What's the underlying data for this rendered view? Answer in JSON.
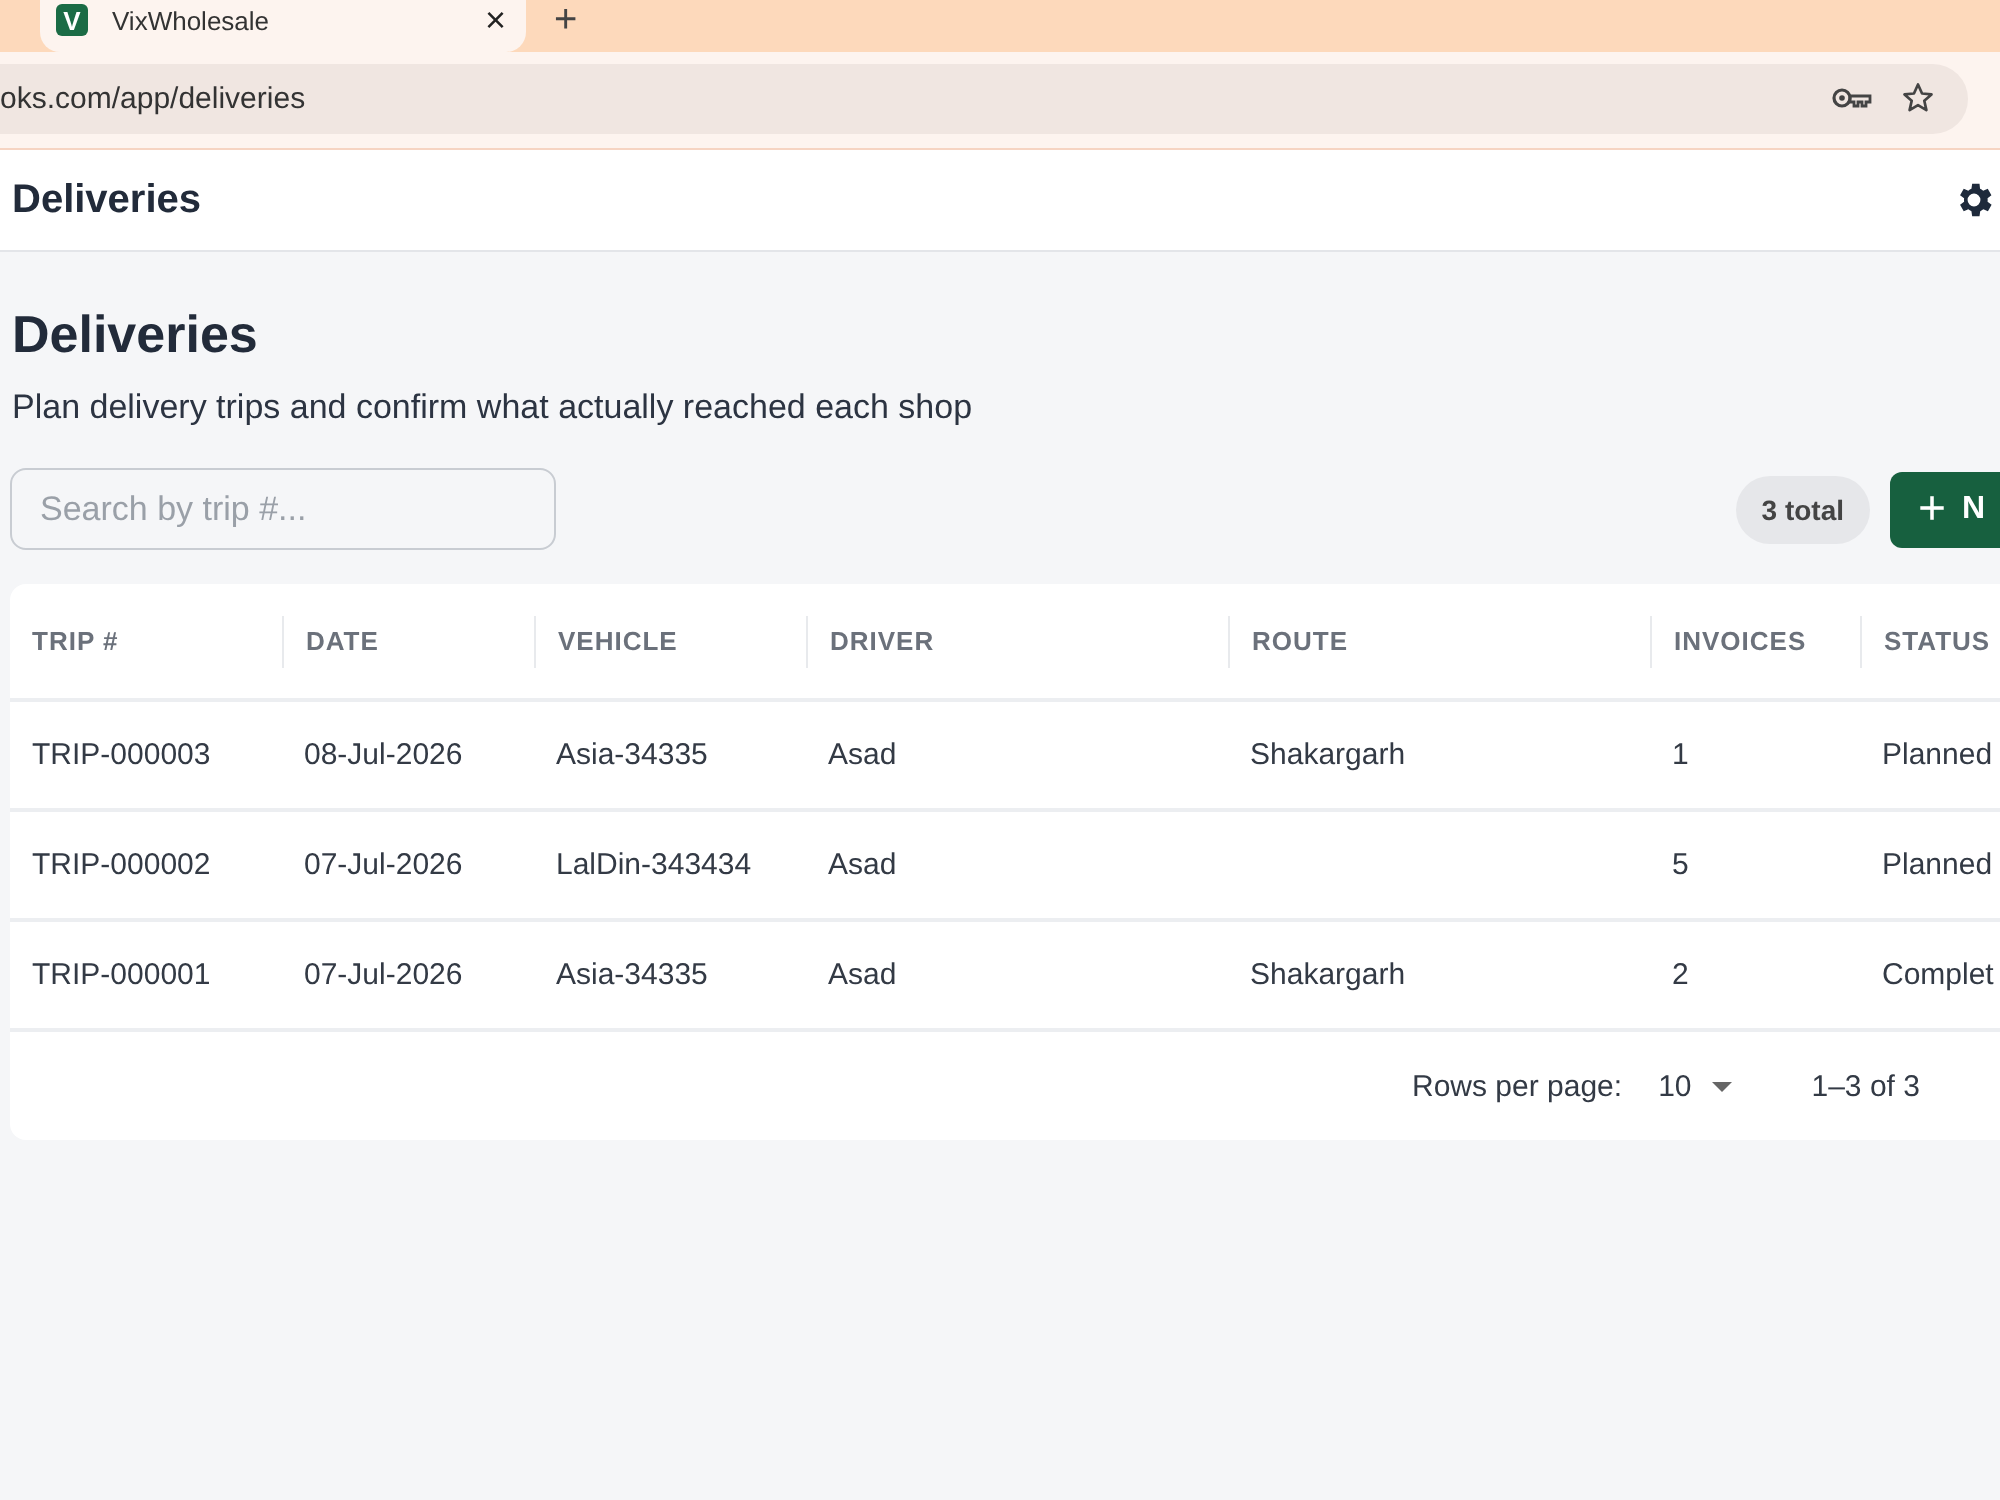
{
  "browser": {
    "tab": {
      "favicon_letter": "V",
      "title": "VixWholesale",
      "close": "×"
    },
    "new_tab": "+",
    "address": "oks.com/app/deliveries"
  },
  "app_bar": {
    "title": "Deliveries"
  },
  "page": {
    "title": "Deliveries",
    "subtitle": "Plan delivery trips and confirm what actually reached each shop"
  },
  "search": {
    "placeholder": "Search by trip #..."
  },
  "total": "3 total",
  "new_button": {
    "icon": "+",
    "label": "N"
  },
  "table": {
    "columns": [
      "TRIP #",
      "DATE",
      "VEHICLE",
      "DRIVER",
      "ROUTE",
      "INVOICES",
      "STATUS"
    ],
    "rows": [
      {
        "cells": [
          "TRIP-000003",
          "08-Jul-2026",
          "Asia-34335",
          "Asad",
          "Shakargarh",
          "1",
          "Planned"
        ]
      },
      {
        "cells": [
          "TRIP-000002",
          "07-Jul-2026",
          "LalDin-343434",
          "Asad",
          "",
          "5",
          "Planned"
        ]
      },
      {
        "cells": [
          "TRIP-000001",
          "07-Jul-2026",
          "Asia-34335",
          "Asad",
          "Shakargarh",
          "2",
          "Complet"
        ]
      }
    ]
  },
  "pagination": {
    "rows_per_page_label": "Rows per page:",
    "rows_per_page": "10",
    "range": "1–3 of 3"
  }
}
